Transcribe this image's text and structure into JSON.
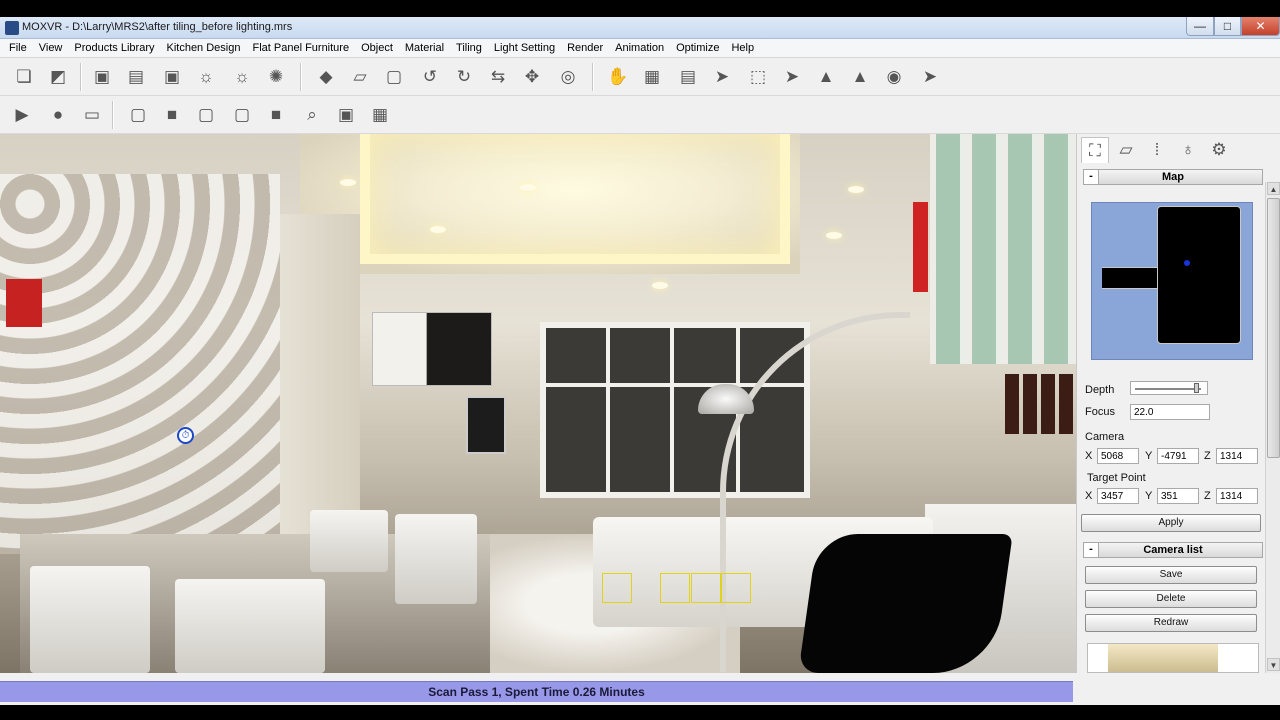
{
  "window": {
    "title": "MOXVR - D:\\Larry\\MRS2\\after tiling_before lighting.mrs",
    "min_glyph": "—",
    "max_glyph": "□",
    "close_glyph": "✕"
  },
  "menu": [
    "File",
    "View",
    "Products Library",
    "Kitchen Design",
    "Flat Panel Furniture",
    "Object",
    "Material",
    "Tiling",
    "Light Setting",
    "Render",
    "Animation",
    "Optimize",
    "Help"
  ],
  "toolbar1": {
    "icons": [
      "copy-icon",
      "paste-icon",
      "delete-object-icon",
      "layers-icon",
      "delete-layer-icon",
      "rotate-light-icon",
      "sun-icon",
      "starburst-icon",
      "cube-solid-icon",
      "panel-icon",
      "cube-wire-icon",
      "rotate-left-icon",
      "rotate-3d-icon",
      "swap-icon",
      "move-icon",
      "target-icon",
      "hand-icon",
      "box-stack-icon",
      "pages-icon",
      "pointer-icon",
      "select-box-icon",
      "pointer-alt-icon",
      "pyramid-icon",
      "cone-icon",
      "binoculars-icon",
      "pointer-plus-icon"
    ],
    "glyphs": [
      "❏",
      "◩",
      "▣",
      "▤",
      "▣",
      "☼",
      "☼",
      "✺",
      "◆",
      "▱",
      "▢",
      "↺",
      "↻",
      "⇆",
      "✥",
      "◎",
      "✋",
      "▦",
      "▤",
      "➤",
      "⬚",
      "➤",
      "▲",
      "▲",
      "◉",
      "➤"
    ]
  },
  "toolbar2": {
    "icons": [
      "play-icon",
      "record-icon",
      "camera-icon",
      "view-front-icon",
      "view-back-icon",
      "view-left-icon",
      "view-right-icon",
      "view-top-icon",
      "zoom-icon",
      "fit-view-icon",
      "grid-view-icon"
    ],
    "glyphs": [
      "▶",
      "●",
      "▭",
      "▢",
      "■",
      "▢",
      "▢",
      "■",
      "⌕",
      "▣",
      "▦"
    ]
  },
  "panel": {
    "tab_icons": [
      "camera-tab-icon",
      "object-tab-icon",
      "material-tab-icon",
      "light-tab-icon",
      "settings-tab-icon"
    ],
    "tab_glyphs": [
      "⛶",
      "▱",
      "⁞",
      "♁",
      "⚙"
    ],
    "map_title": "Map",
    "collapse": "-",
    "depth_label": "Depth",
    "depth_level": 0.95,
    "focus_label": "Focus",
    "focus_value": "22.0",
    "camera_label": "Camera",
    "camera": {
      "x": "5068",
      "y": "-4791",
      "z": "1314"
    },
    "target_label": "Target Point",
    "target": {
      "x": "3457",
      "y": "351",
      "z": "1314"
    },
    "axis_x": "X",
    "axis_y": "Y",
    "axis_z": "Z",
    "apply": "Apply",
    "camera_list_title": "Camera list",
    "save": "Save",
    "delete": "Delete",
    "redraw": "Redraw",
    "scroll_up": "▲",
    "scroll_down": "▼"
  },
  "status": "Scan Pass 1, Spent Time 0.26 Minutes",
  "camera_marker_glyph": "⏱"
}
